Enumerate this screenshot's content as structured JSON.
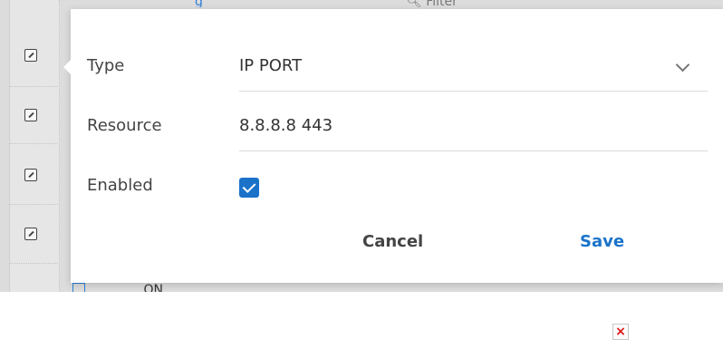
{
  "form": {
    "type_label": "Type",
    "type_value": "IP PORT",
    "resource_label": "Resource",
    "resource_value": "8.8.8.8 443",
    "enabled_label": "Enabled",
    "enabled_checked": true
  },
  "actions": {
    "cancel_label": "Cancel",
    "save_label": "Save"
  },
  "background": {
    "filter_placeholder": "Filter",
    "row_count_visible": 5,
    "partial_row_text": "ON"
  },
  "colors": {
    "accent": "#1a73c9",
    "table_bg": "#dcdcdc",
    "modal_bg": "#ffffff",
    "broken_image_x": "#dd1111"
  },
  "icons": {
    "row_action": "edit-icon",
    "dropdown": "chevron-down-icon",
    "checkbox": "checkbox-checked-icon",
    "broken": "broken-image-icon"
  }
}
